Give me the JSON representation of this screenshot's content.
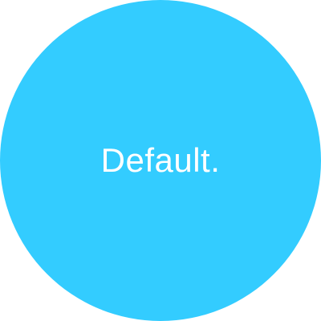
{
  "circle": {
    "label": "Default.",
    "fill_color": "#33ccff",
    "text_color": "#ffffff"
  }
}
